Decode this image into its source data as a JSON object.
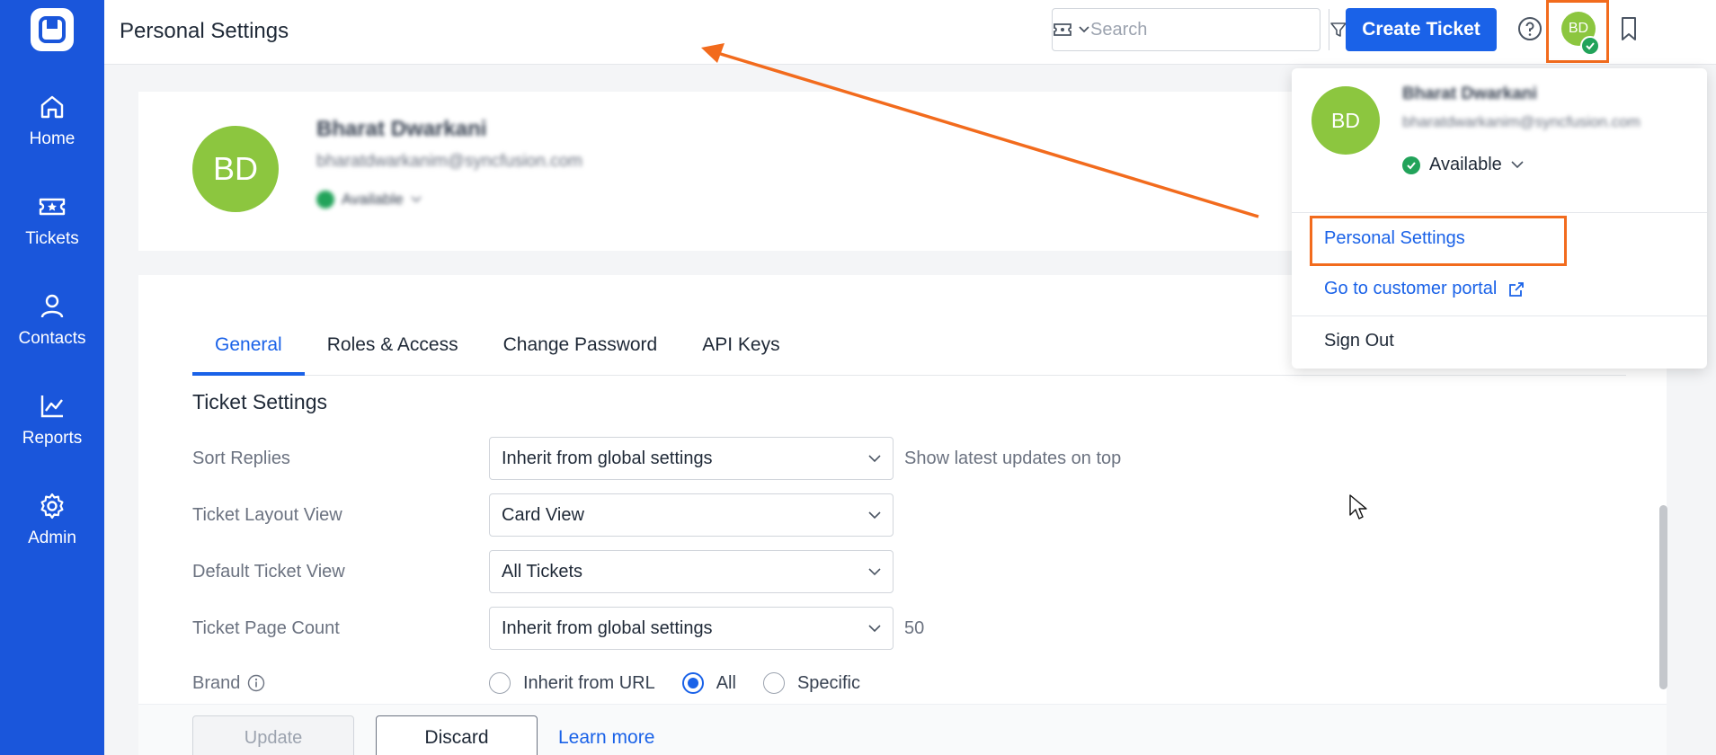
{
  "sidebar": {
    "items": [
      {
        "label": "Home",
        "icon": "home-icon"
      },
      {
        "label": "Tickets",
        "icon": "ticket-icon"
      },
      {
        "label": "Contacts",
        "icon": "user-icon"
      },
      {
        "label": "Reports",
        "icon": "chart-icon"
      },
      {
        "label": "Admin",
        "icon": "gear-icon"
      }
    ]
  },
  "header": {
    "title": "Personal Settings",
    "search_placeholder": "Search",
    "create_button": "Create Ticket",
    "avatar_initials": "BD"
  },
  "profile": {
    "initials": "BD",
    "name": "Bharat Dwarkani",
    "email": "bharatdwarkanim@syncfusion.com",
    "status": "Available"
  },
  "tabs": [
    {
      "label": "General",
      "active": true
    },
    {
      "label": "Roles & Access",
      "active": false
    },
    {
      "label": "Change Password",
      "active": false
    },
    {
      "label": "API Keys",
      "active": false
    }
  ],
  "settings": {
    "section_title": "Ticket Settings",
    "sort_replies": {
      "label": "Sort Replies",
      "value": "Inherit from global settings",
      "hint": "Show latest updates on top"
    },
    "layout_view": {
      "label": "Ticket Layout View",
      "value": "Card View"
    },
    "default_view": {
      "label": "Default Ticket View",
      "value": "All Tickets"
    },
    "page_count": {
      "label": "Ticket Page Count",
      "value": "Inherit from global settings",
      "hint": "50"
    },
    "brand": {
      "label": "Brand",
      "options": [
        {
          "label": "Inherit from URL",
          "checked": false
        },
        {
          "label": "All",
          "checked": true
        },
        {
          "label": "Specific",
          "checked": false
        }
      ]
    }
  },
  "footer": {
    "update": "Update",
    "discard": "Discard",
    "learn_more": "Learn more"
  },
  "dropdown": {
    "initials": "BD",
    "name": "Bharat Dwarkani",
    "email": "bharatdwarkanim@syncfusion.com",
    "status": "Available",
    "personal_settings": "Personal Settings",
    "customer_portal": "Go to customer portal",
    "sign_out": "Sign Out"
  },
  "colors": {
    "brand_blue": "#1a56db",
    "accent": "#1a62e8",
    "avatar_green": "#8cc63f",
    "status_green": "#22a35a",
    "highlight_orange": "#f26b1d"
  }
}
